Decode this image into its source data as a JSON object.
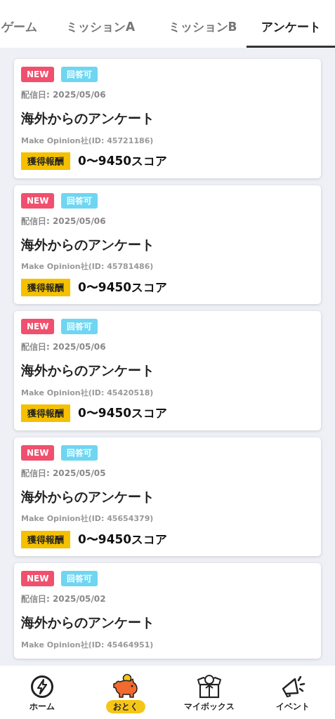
{
  "tabs": [
    {
      "label": "ゲーム",
      "selected": false
    },
    {
      "label": "ミッションA",
      "selected": false
    },
    {
      "label": "ミッションB",
      "selected": false
    },
    {
      "label": "アンケート",
      "selected": true
    }
  ],
  "surveys": [
    {
      "badges": [
        {
          "label": "NEW",
          "kind": "new"
        },
        {
          "label": "回答可",
          "kind": "status"
        }
      ],
      "date": "配信日: 2025/05/06",
      "title": "海外からのアンケート",
      "company": "Make Opinion社(ID: 45721186)",
      "reward_label": "獲得報酬",
      "reward": "0〜9450スコア"
    },
    {
      "badges": [
        {
          "label": "NEW",
          "kind": "new"
        },
        {
          "label": "回答可",
          "kind": "status"
        }
      ],
      "date": "配信日: 2025/05/06",
      "title": "海外からのアンケート",
      "company": "Make Opinion社(ID: 45781486)",
      "reward_label": "獲得報酬",
      "reward": "0〜9450スコア"
    },
    {
      "badges": [
        {
          "label": "NEW",
          "kind": "new"
        },
        {
          "label": "回答可",
          "kind": "status"
        }
      ],
      "date": "配信日: 2025/05/06",
      "title": "海外からのアンケート",
      "company": "Make Opinion社(ID: 45420518)",
      "reward_label": "獲得報酬",
      "reward": "0〜9450スコア"
    },
    {
      "badges": [
        {
          "label": "NEW",
          "kind": "new"
        },
        {
          "label": "回答可",
          "kind": "status"
        }
      ],
      "date": "配信日: 2025/05/05",
      "title": "海外からのアンケート",
      "company": "Make Opinion社(ID: 45654379)",
      "reward_label": "獲得報酬",
      "reward": "0〜9450スコア"
    },
    {
      "badges": [
        {
          "label": "NEW",
          "kind": "new"
        },
        {
          "label": "回答可",
          "kind": "status"
        }
      ],
      "date": "配信日: 2025/05/02",
      "title": "海外からのアンケート",
      "company": "Make Opinion社(ID: 45464951)"
    }
  ],
  "nav": [
    {
      "label": "ホーム",
      "kind": "home",
      "selected": false
    },
    {
      "label": "おとく",
      "kind": "savings",
      "selected": true
    },
    {
      "label": "マイボックス",
      "kind": "box",
      "selected": false
    },
    {
      "label": "イベント",
      "kind": "event",
      "selected": false
    }
  ]
}
